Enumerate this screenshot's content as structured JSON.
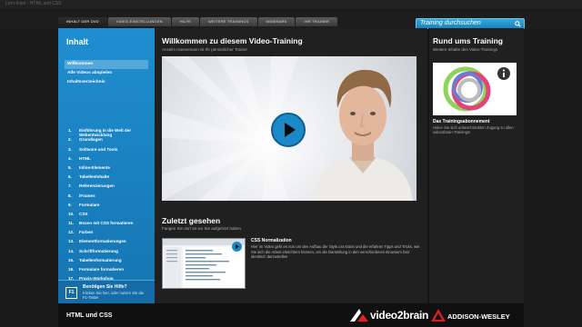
{
  "window": {
    "title": "Lern-Insel - HTML und CSS"
  },
  "tabs": [
    {
      "label": "Inhalt der DVD",
      "active": true
    },
    {
      "label": "Video-Einstellungen",
      "active": false
    },
    {
      "label": "Hilfe",
      "active": false
    },
    {
      "label": "Weitere Trainings",
      "active": false
    },
    {
      "label": "Webinare",
      "active": false
    },
    {
      "label": "Ihr Trainer",
      "active": false
    }
  ],
  "search": {
    "placeholder": "Training durchsuchen",
    "icon": "search-icon"
  },
  "sidebar": {
    "title": "Inhalt",
    "nav": [
      {
        "label": "Willkommen",
        "selected": true
      },
      {
        "label": "Alle Videos abspielen",
        "selected": false
      },
      {
        "label": "Inhaltsverzeichnis",
        "selected": false
      }
    ],
    "chapters": [
      {
        "num": "1.",
        "label": "Einführung in die Welt der Webentwicklung"
      },
      {
        "num": "2.",
        "label": "Grundlagen"
      },
      {
        "num": "3.",
        "label": "Software und Tools"
      },
      {
        "num": "4.",
        "label": "HTML"
      },
      {
        "num": "5.",
        "label": "Inline-Elemente"
      },
      {
        "num": "6.",
        "label": "Tabellenlnhalte"
      },
      {
        "num": "7.",
        "label": "Referenzierungen"
      },
      {
        "num": "8.",
        "label": "iFrames"
      },
      {
        "num": "9.",
        "label": "Formulare"
      },
      {
        "num": "10.",
        "label": "CSS"
      },
      {
        "num": "11.",
        "label": "Boxen mit CSS formatieren"
      },
      {
        "num": "12.",
        "label": "Farben"
      },
      {
        "num": "13.",
        "label": "Elementformatierungen"
      },
      {
        "num": "14.",
        "label": "Schriftformatierung"
      },
      {
        "num": "15.",
        "label": "Tabellenformatierung"
      },
      {
        "num": "16.",
        "label": "Formulare formatieren"
      },
      {
        "num": "17.",
        "label": "Praxis-Workshop"
      }
    ],
    "help": {
      "key": "F1",
      "title": "Benötigen Sie Hilfe?",
      "text": "Klicken Sie hier, oder nutzen Sie die F1-Taste!"
    }
  },
  "main": {
    "title": "Willkommen zu diesem Video-Training",
    "subtitle": "Anselm Hannemann ist Ihr persönlicher Trainer",
    "recent_title": "Zuletzt gesehen",
    "recent_subtitle": "Fangen Sie dort an wo Sie aufgehört haben",
    "recent_item_title": "CSS Normalization",
    "recent_item_desc": "Hier im Video geht es nun um den Aufbau der Style.css-Datei und die erfahren Tipps und Tricks, wie Sie sich die Arbeit erleichtern können, um die Darstellung in den verschiedenen Browsern fast identisch darzustellen"
  },
  "right": {
    "title": "Rund ums Training",
    "subtitle": "Weitere Inhalte des Video-Trainings",
    "item_title": "Das Trainingsabonnement",
    "item_desc": "Holen Sie sich unbeschränkten Zugang zu allen video2brain-Trainings!",
    "info_icon": "info-icon"
  },
  "footer": {
    "course": "HTML und CSS",
    "brand1": "video2brain",
    "brand2": "ADDISON-WESLEY"
  },
  "colors": {
    "accent": "#1b88c8",
    "sidebar": "#1a86c7",
    "background": "#1a1a1a"
  }
}
